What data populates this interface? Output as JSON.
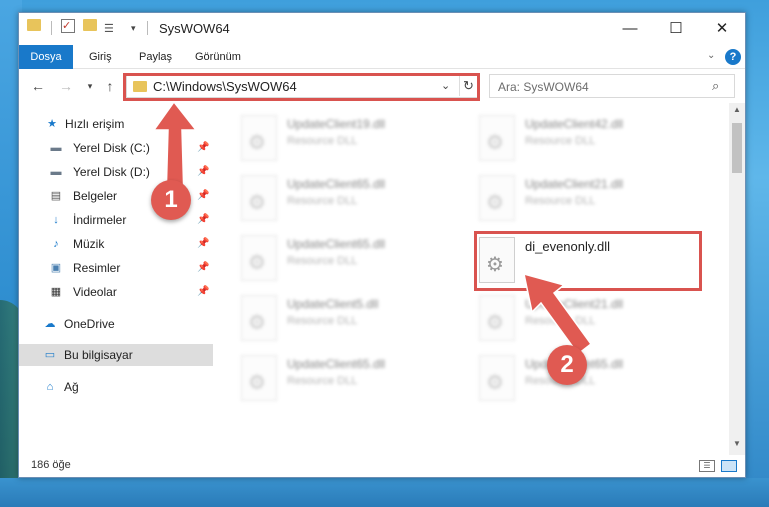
{
  "window": {
    "title": "SysWOW64",
    "buttons": {
      "minimize": "—",
      "maximize": "☐",
      "close": "✕"
    }
  },
  "ribbon": {
    "tabs": [
      "Dosya",
      "Giriş",
      "Paylaş",
      "Görünüm"
    ],
    "help": "?"
  },
  "navigation": {
    "address": "C:\\Windows\\SysWOW64",
    "search_placeholder": "Ara: SysWOW64"
  },
  "sidebar": {
    "items": [
      {
        "label": "Hızlı erişim",
        "icon": "star-icon",
        "pinned": false
      },
      {
        "label": "Yerel Disk (C:)",
        "icon": "drive-icon",
        "pinned": true
      },
      {
        "label": "Yerel Disk (D:)",
        "icon": "drive-icon",
        "pinned": true
      },
      {
        "label": "Belgeler",
        "icon": "document-icon",
        "pinned": true
      },
      {
        "label": "İndirmeler",
        "icon": "download-icon",
        "pinned": true
      },
      {
        "label": "Müzik",
        "icon": "music-icon",
        "pinned": true
      },
      {
        "label": "Resimler",
        "icon": "picture-icon",
        "pinned": true
      },
      {
        "label": "Videolar",
        "icon": "video-icon",
        "pinned": true
      },
      {
        "label": "OneDrive",
        "icon": "cloud-icon",
        "pinned": false
      },
      {
        "label": "Bu bilgisayar",
        "icon": "computer-icon",
        "pinned": false
      },
      {
        "label": "Ağ",
        "icon": "network-icon",
        "pinned": false
      }
    ]
  },
  "files": [
    {
      "name": "UpdateClient19.dll",
      "type": "Resource DLL",
      "blurred": true
    },
    {
      "name": "UpdateClient42.dll",
      "type": "Resource DLL",
      "blurred": true
    },
    {
      "name": "UpdateClient65.dll",
      "type": "Resource DLL",
      "blurred": true
    },
    {
      "name": "UpdateClient21.dll",
      "type": "Resource DLL",
      "blurred": true
    },
    {
      "name": "UpdateClient65.dll",
      "type": "Resource DLL",
      "blurred": true
    },
    {
      "name": "di_evenonly.dll",
      "type": "",
      "blurred": false
    },
    {
      "name": "UpdateClient5.dll",
      "type": "Resource DLL",
      "blurred": true
    },
    {
      "name": "UpdateClient21.dll",
      "type": "Resource DLL",
      "blurred": true
    },
    {
      "name": "UpdateClient65.dll",
      "type": "Resource DLL",
      "blurred": true
    },
    {
      "name": "UpdateClient65.dll",
      "type": "Resource DLL",
      "blurred": true
    }
  ],
  "status": {
    "item_count": "186 öğe"
  },
  "annotations": {
    "badge_1": "1",
    "badge_2": "2",
    "color": "#e05a52"
  },
  "colors": {
    "accent": "#1979ca",
    "highlight": "#d9534f"
  }
}
